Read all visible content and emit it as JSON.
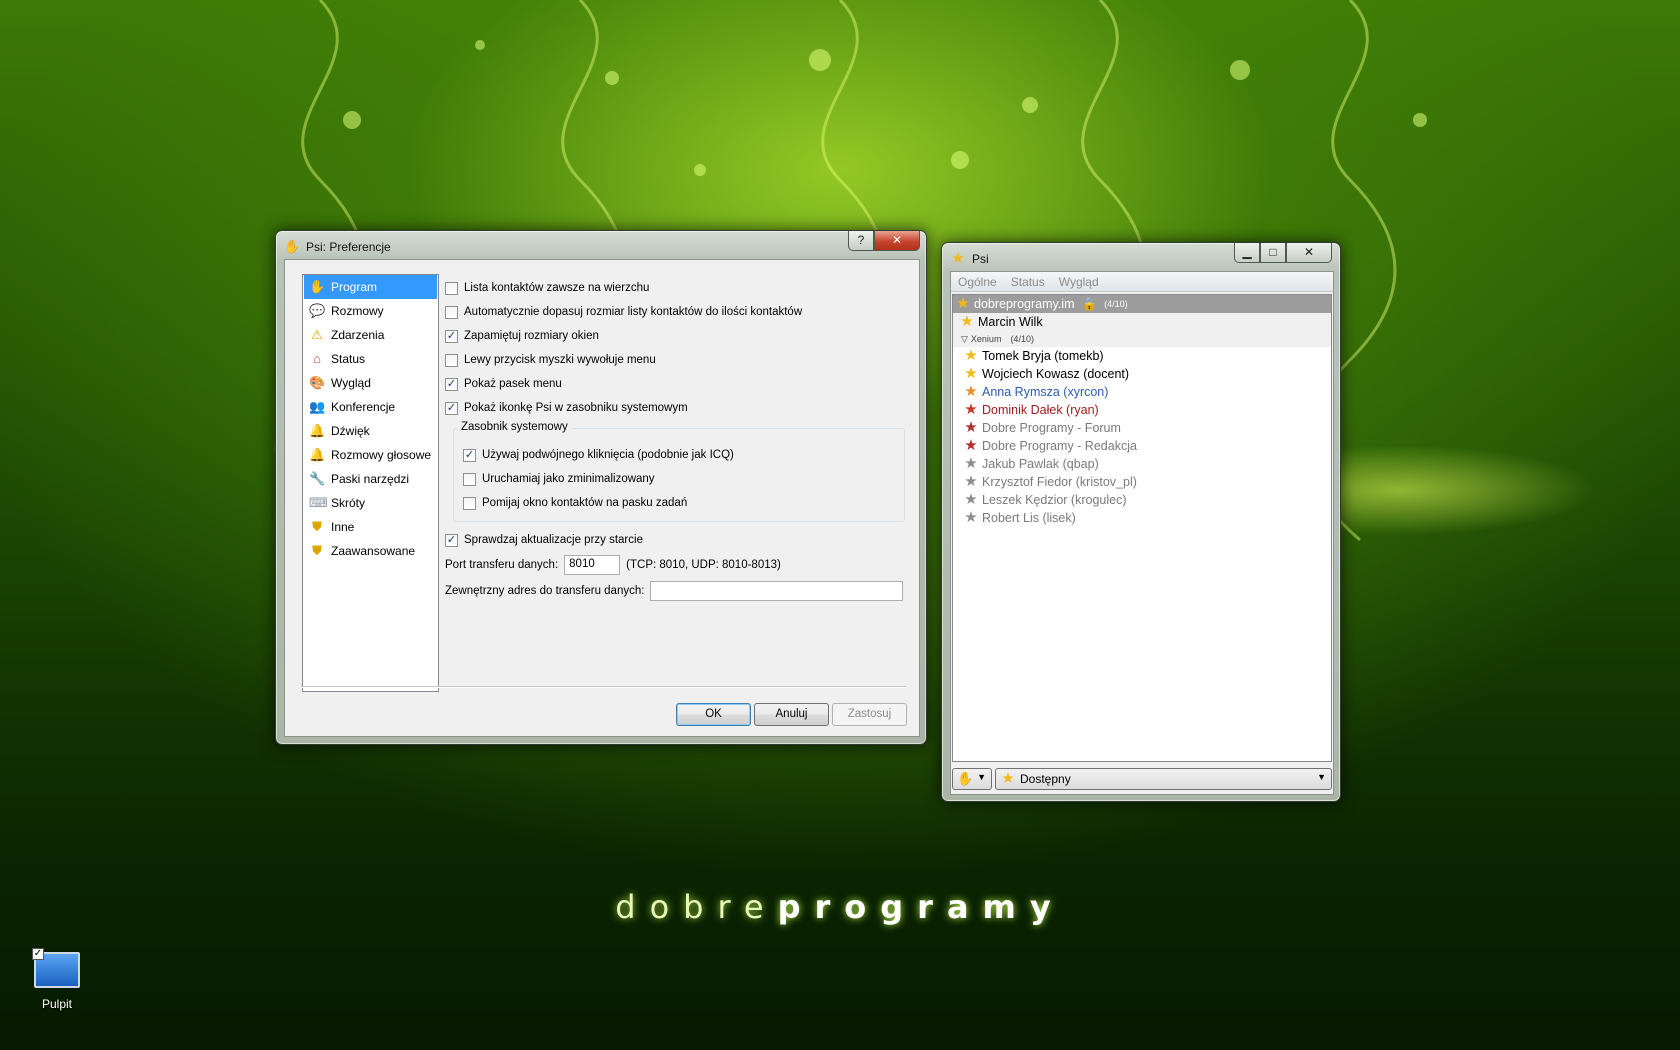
{
  "wallpaper": {
    "brand_light": "dobre",
    "brand_bold": "programy"
  },
  "desktop": {
    "icon_label": "Pulpit"
  },
  "prefs": {
    "title": "Psi: Preferencje",
    "help_glyph": "?",
    "close_glyph": "✕",
    "nav": [
      {
        "label": "Program",
        "icon": "psi-hand-icon",
        "selected": true
      },
      {
        "label": "Rozmowy",
        "icon": "speech-bubble-icon"
      },
      {
        "label": "Zdarzenia",
        "icon": "warning-icon"
      },
      {
        "label": "Status",
        "icon": "house-icon"
      },
      {
        "label": "Wygląd",
        "icon": "palette-icon"
      },
      {
        "label": "Konferencje",
        "icon": "people-icon"
      },
      {
        "label": "Dźwięk",
        "icon": "bell-icon"
      },
      {
        "label": "Rozmowy głosowe",
        "icon": "voice-icon"
      },
      {
        "label": "Paski narzędzi",
        "icon": "toolbar-icon"
      },
      {
        "label": "Skróty",
        "icon": "shortcut-icon"
      },
      {
        "label": "Inne",
        "icon": "shield-icon"
      },
      {
        "label": "Zaawansowane",
        "icon": "shield-icon"
      }
    ],
    "options": [
      {
        "label": "Lista kontaktów zawsze na wierzchu",
        "checked": false
      },
      {
        "label": "Automatycznie dopasuj rozmiar listy kontaktów do ilości kontaktów",
        "checked": false
      },
      {
        "label": "Zapamiętuj rozmiary okien",
        "checked": true
      },
      {
        "label": "Lewy przycisk myszki wywołuje menu",
        "checked": false
      },
      {
        "label": "Pokaż pasek menu",
        "checked": true
      },
      {
        "label": "Pokaż ikonkę Psi w zasobniku systemowym",
        "checked": true
      }
    ],
    "tray_group": {
      "label": "Zasobnik systemowy",
      "options": [
        {
          "label": "Używaj podwójnego kliknięcia (podobnie jak ICQ)",
          "checked": true
        },
        {
          "label": "Uruchamiaj jako zminimalizowany",
          "checked": false
        },
        {
          "label": "Pomijaj okno kontaktów na pasku zadań",
          "checked": false
        }
      ]
    },
    "updates": {
      "label": "Sprawdzaj aktualizacje przy starcie",
      "checked": true
    },
    "port": {
      "label": "Port transferu danych:",
      "value": "8010",
      "hint": "(TCP: 8010, UDP: 8010-8013)"
    },
    "external": {
      "label": "Zewnętrzny adres do transferu danych:",
      "value": ""
    },
    "buttons": {
      "ok": "OK",
      "cancel": "Anuluj",
      "apply": "Zastosuj"
    }
  },
  "psi": {
    "title": "Psi",
    "menu": [
      "Ogólne",
      "Status",
      "Wygląd"
    ],
    "account": {
      "name": "dobreprogramy.im",
      "count": "(4/10)"
    },
    "self_contact": "Marcin Wilk",
    "group": {
      "name": "Xenium",
      "count": "(4/10)"
    },
    "contacts": [
      {
        "name": "Tomek Bryja (tomekb)",
        "color": "#000000",
        "status": "online"
      },
      {
        "name": "Wojciech Kowasz (docent)",
        "color": "#000000",
        "status": "online"
      },
      {
        "name": "Anna Rymsza (xyrcon)",
        "color": "#2a5db0",
        "status": "chat"
      },
      {
        "name": "Dominik Dałek (ryan)",
        "color": "#9b1b1b",
        "status": "dnd"
      },
      {
        "name": "Dobre Programy - Forum",
        "color": "#7a7a7a",
        "status": "unknown"
      },
      {
        "name": "Dobre Programy - Redakcja",
        "color": "#7a7a7a",
        "status": "unknown"
      },
      {
        "name": "Jakub Pawlak (qbap)",
        "color": "#7a7a7a",
        "status": "offline"
      },
      {
        "name": "Krzysztof Fiedor (kristov_pl)",
        "color": "#7a7a7a",
        "status": "offline"
      },
      {
        "name": "Leszek Kędzior (krogulec)",
        "color": "#7a7a7a",
        "status": "offline"
      },
      {
        "name": "Robert Lis (lisek)",
        "color": "#7a7a7a",
        "status": "offline"
      }
    ],
    "status_select": "Dostępny"
  }
}
